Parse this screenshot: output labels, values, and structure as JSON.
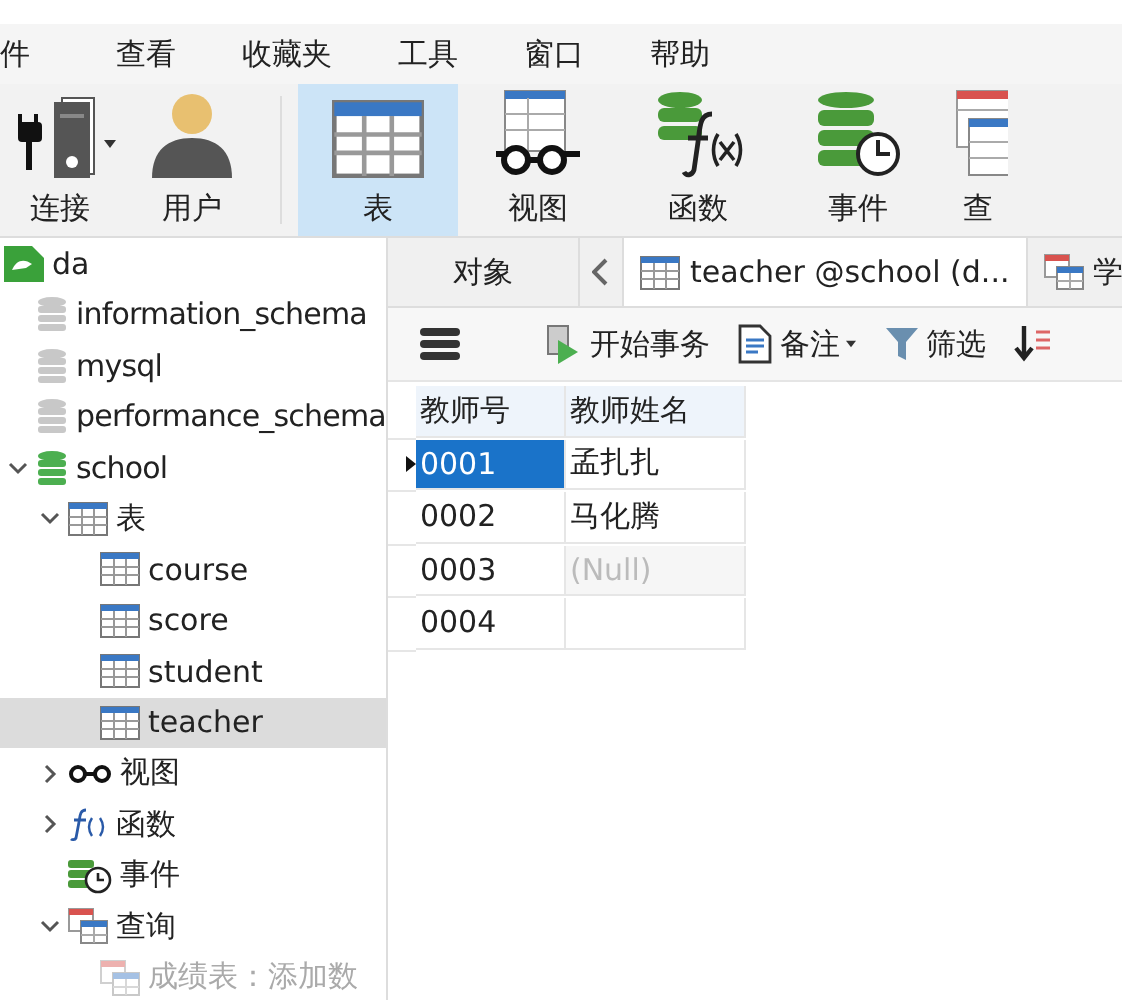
{
  "menu": [
    "件",
    "查看",
    "收藏夹",
    "工具",
    "窗口",
    "帮助"
  ],
  "toolbar": [
    {
      "kind": "connection",
      "label": "连接",
      "selected": false,
      "dropdown": true
    },
    {
      "kind": "user",
      "label": "用户",
      "selected": false,
      "dropdown": false
    },
    {
      "kind": "table",
      "label": "表",
      "selected": true,
      "dropdown": false
    },
    {
      "kind": "view",
      "label": "视图",
      "selected": false,
      "dropdown": false
    },
    {
      "kind": "function",
      "label": "函数",
      "selected": false,
      "dropdown": false
    },
    {
      "kind": "event",
      "label": "事件",
      "selected": false,
      "dropdown": false
    },
    {
      "kind": "query",
      "label": "查",
      "selected": false,
      "dropdown": false
    }
  ],
  "tree": [
    {
      "kind": "connection",
      "label": "da",
      "expanded": true,
      "selected": false,
      "dimmed": false,
      "children": [
        {
          "kind": "database",
          "label": "information_schema",
          "open": false,
          "selected": false,
          "dimmed": false
        },
        {
          "kind": "database",
          "label": "mysql",
          "open": false,
          "selected": false,
          "dimmed": false
        },
        {
          "kind": "database",
          "label": "performance_schema",
          "open": false,
          "selected": false,
          "dimmed": false
        },
        {
          "kind": "database",
          "label": "school",
          "open": true,
          "expanded": true,
          "selected": false,
          "dimmed": false,
          "children": [
            {
              "kind": "tables",
              "label": "表",
              "expanded": true,
              "selected": false,
              "dimmed": false,
              "children": [
                {
                  "kind": "table",
                  "label": "course",
                  "selected": false,
                  "dimmed": false
                },
                {
                  "kind": "table",
                  "label": "score",
                  "selected": false,
                  "dimmed": false
                },
                {
                  "kind": "table",
                  "label": "student",
                  "selected": false,
                  "dimmed": false
                },
                {
                  "kind": "table",
                  "label": "teacher",
                  "selected": true,
                  "dimmed": false
                }
              ]
            },
            {
              "kind": "views",
              "label": "视图",
              "expanded": false,
              "selected": false,
              "dimmed": false
            },
            {
              "kind": "functions",
              "label": "函数",
              "expanded": false,
              "selected": false,
              "dimmed": false
            },
            {
              "kind": "events",
              "label": "事件",
              "selected": false,
              "dimmed": false
            },
            {
              "kind": "queries",
              "label": "查询",
              "expanded": true,
              "selected": false,
              "dimmed": false,
              "children": [
                {
                  "kind": "query",
                  "label": "成绩表：添加数",
                  "selected": false,
                  "dimmed": true
                }
              ]
            }
          ]
        }
      ]
    }
  ],
  "tabs": [
    {
      "kind": "objects",
      "label": "对象",
      "selected": false
    },
    {
      "kind": "table",
      "label": "teacher @school (d...",
      "selected": true
    },
    {
      "kind": "query",
      "label": "学",
      "selected": false
    }
  ],
  "grid_toolbar": [
    {
      "kind": "menu"
    },
    {
      "kind": "transaction",
      "label": "开始事务"
    },
    {
      "kind": "note",
      "label": "备注",
      "dropdown": true
    },
    {
      "kind": "filter",
      "label": "筛选"
    },
    {
      "kind": "sort"
    }
  ],
  "table": {
    "columns": [
      "教师号",
      "教师姓名"
    ],
    "rows": [
      {
        "current": true,
        "cells": [
          {
            "text": "0001",
            "selected": true,
            "null": false
          },
          {
            "text": "孟扎扎",
            "selected": false,
            "null": false
          }
        ]
      },
      {
        "current": false,
        "cells": [
          {
            "text": "0002",
            "selected": false,
            "null": false
          },
          {
            "text": "马化腾",
            "selected": false,
            "null": false
          }
        ]
      },
      {
        "current": false,
        "cells": [
          {
            "text": "0003",
            "selected": false,
            "null": false
          },
          {
            "text": "(Null)",
            "selected": false,
            "null": true
          }
        ]
      },
      {
        "current": false,
        "cells": [
          {
            "text": "0004",
            "selected": false,
            "null": false
          },
          {
            "text": "",
            "selected": false
          }
        ]
      }
    ]
  }
}
